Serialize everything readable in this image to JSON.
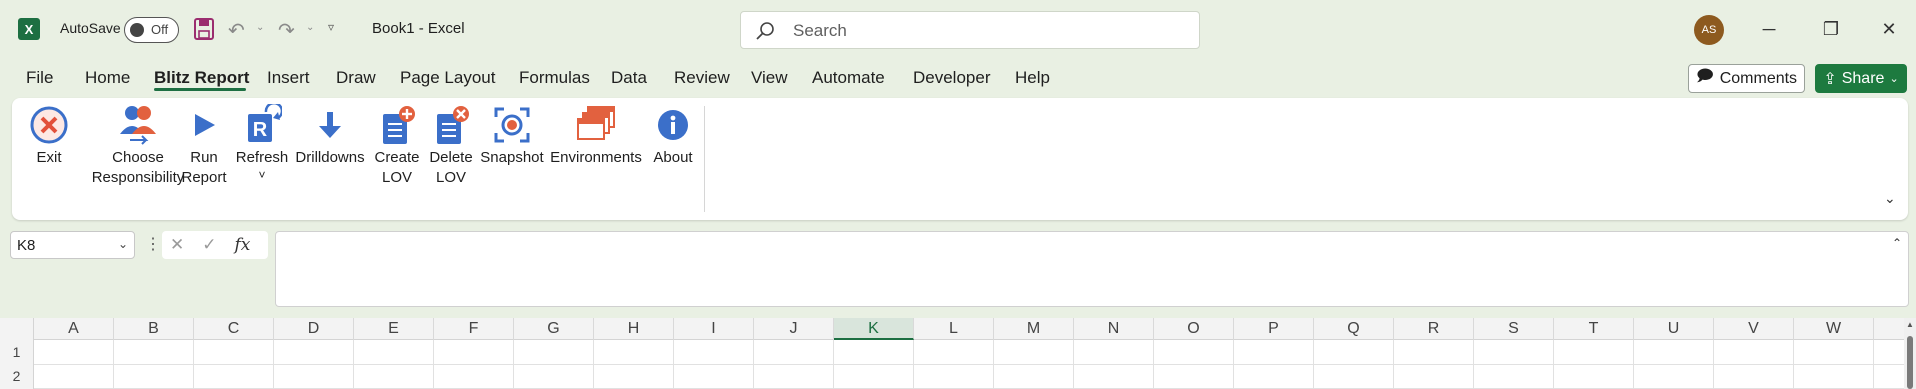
{
  "titlebar": {
    "app_logo": "X",
    "autosave_label": "AutoSave",
    "autosave_state": "Off",
    "doc_title": "Book1  -  Excel",
    "search_placeholder": "Search",
    "avatar_initials": "AS"
  },
  "tabs": [
    {
      "label": "File"
    },
    {
      "label": "Home"
    },
    {
      "label": "Blitz Report"
    },
    {
      "label": "Insert"
    },
    {
      "label": "Draw"
    },
    {
      "label": "Page Layout"
    },
    {
      "label": "Formulas"
    },
    {
      "label": "Data"
    },
    {
      "label": "Review"
    },
    {
      "label": "View"
    },
    {
      "label": "Automate"
    },
    {
      "label": "Developer"
    },
    {
      "label": "Help"
    }
  ],
  "active_tab": "Blitz Report",
  "actions": {
    "comments_label": "Comments",
    "share_label": "Share"
  },
  "ribbon": {
    "buttons": [
      {
        "line1": "Exit",
        "line2": "",
        "icon": "exit-icon"
      },
      {
        "line1": "Choose",
        "line2": "Responsibility",
        "icon": "users-icon"
      },
      {
        "line1": "Run",
        "line2": "Report",
        "icon": "play-icon"
      },
      {
        "line1": "Refresh",
        "line2": "˅",
        "icon": "refresh-icon"
      },
      {
        "line1": "Drilldowns",
        "line2": "",
        "icon": "down-arrow-icon"
      },
      {
        "line1": "Create",
        "line2": "LOV",
        "icon": "doc-add-icon"
      },
      {
        "line1": "Delete",
        "line2": "LOV",
        "icon": "doc-delete-icon"
      },
      {
        "line1": "Snapshot",
        "line2": "",
        "icon": "camera-icon"
      },
      {
        "line1": "Environments",
        "line2": "",
        "icon": "windows-icon"
      },
      {
        "line1": "About",
        "line2": "",
        "icon": "info-icon"
      }
    ]
  },
  "formula_bar": {
    "namebox_value": "K8",
    "fx_label": "fx",
    "formula_value": ""
  },
  "grid": {
    "columns": [
      "A",
      "B",
      "C",
      "D",
      "E",
      "F",
      "G",
      "H",
      "I",
      "J",
      "K",
      "L",
      "M",
      "N",
      "O",
      "P",
      "Q",
      "R",
      "S",
      "T",
      "U",
      "V",
      "W"
    ],
    "selected_column": "K",
    "rows": [
      "1",
      "2"
    ]
  },
  "colors": {
    "accent": "#1d6f42",
    "background": "#e9f0e3"
  }
}
